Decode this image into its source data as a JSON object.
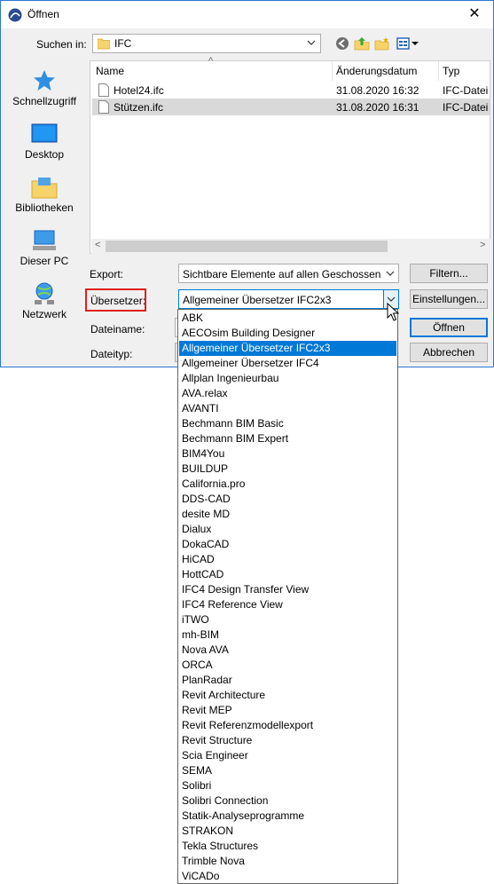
{
  "window": {
    "title": "Öffnen",
    "close_glyph": "✕",
    "colors": {
      "accent": "#0078d7",
      "border": "#2b79d4",
      "highlight_frame": "#e0201c"
    }
  },
  "toolbar": {
    "lookin_label": "Suchen in:",
    "lookin_value": "IFC",
    "icons": [
      "back-icon",
      "up-folder-icon",
      "new-folder-icon",
      "view-menu-icon"
    ]
  },
  "places": [
    {
      "label": "Schnellzugriff",
      "icon": "quick-access-star-icon"
    },
    {
      "label": "Desktop",
      "icon": "desktop-icon"
    },
    {
      "label": "Bibliotheken",
      "icon": "libraries-icon"
    },
    {
      "label": "Dieser PC",
      "icon": "computer-icon"
    },
    {
      "label": "Netzwerk",
      "icon": "network-icon"
    }
  ],
  "filelist": {
    "columns": [
      "Name",
      "Änderungsdatum",
      "Typ"
    ],
    "sort_indicator": "^",
    "rows": [
      {
        "name": "Hotel24.ifc",
        "date": "31.08.2020 16:32",
        "type": "IFC-Datei",
        "selected": false
      },
      {
        "name": "Stützen.ifc",
        "date": "31.08.2020 16:31",
        "type": "IFC-Datei",
        "selected": true
      }
    ],
    "scroll_left": "<",
    "scroll_right": ">"
  },
  "form": {
    "export_label": "Export:",
    "export_value": "Sichtbare Elemente auf allen Geschossen",
    "filter_button": "Filtern...",
    "uebersetzer_label": "Übersetzer:",
    "uebersetzer_value": "Allgemeiner Übersetzer IFC2x3",
    "settings_button": "Einstellungen...",
    "filename_label": "Dateiname:",
    "filetype_label": "Dateityp:",
    "open_button": "Öffnen",
    "cancel_button": "Abbrechen"
  },
  "dropdown": {
    "selected_index": 2,
    "options": [
      "ABK",
      "AECOsim Building Designer",
      "Allgemeiner Übersetzer IFC2x3",
      "Allgemeiner Übersetzer IFC4",
      "Allplan Ingenieurbau",
      "AVA.relax",
      "AVANTI",
      "Bechmann BIM Basic",
      "Bechmann BIM Expert",
      "BIM4You",
      "BUILDUP",
      "California.pro",
      "DDS-CAD",
      "desite MD",
      "Dialux",
      "DokaCAD",
      "HiCAD",
      "HottCAD",
      "IFC4 Design Transfer View",
      "IFC4 Reference View",
      "iTWO",
      "mh-BIM",
      "Nova AVA",
      "ORCA",
      "PlanRadar",
      "Revit Architecture",
      "Revit MEP",
      "Revit Referenzmodellexport",
      "Revit Structure",
      "Scia Engineer",
      "SEMA",
      "Solibri",
      "Solibri Connection",
      "Statik-Analyseprogramme",
      "STRAKON",
      "Tekla Structures",
      "Trimble Nova",
      "ViCADo"
    ]
  }
}
